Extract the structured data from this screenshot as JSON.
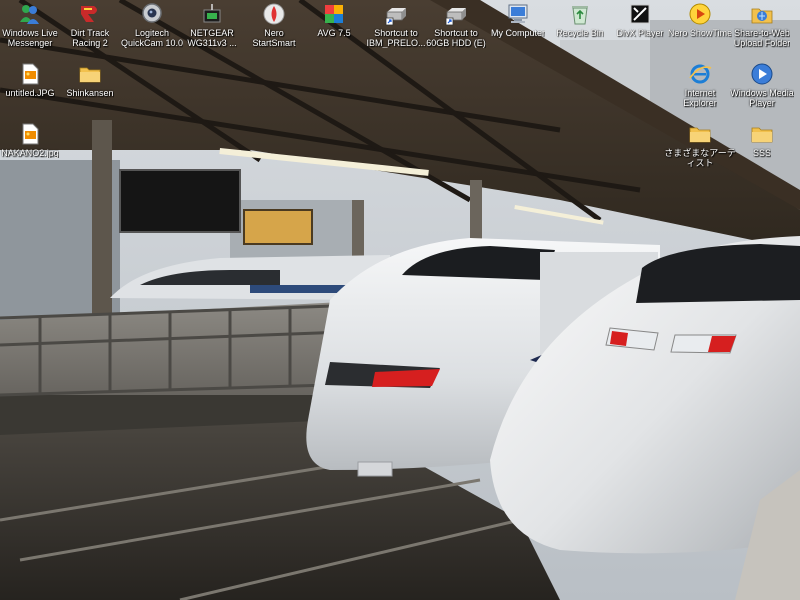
{
  "desktop": {
    "icons": [
      {
        "id": "wlm",
        "label": "Windows Live\nMessenger",
        "icon": "messenger-buddies-icon"
      },
      {
        "id": "dirt",
        "label": "Dirt Track\nRacing 2",
        "icon": "racing-game-icon"
      },
      {
        "id": "logi",
        "label": "Logitech\nQuickCam 10.0",
        "icon": "webcam-icon"
      },
      {
        "id": "netgear",
        "label": "NETGEAR\nWG311v3 ...",
        "icon": "wireless-adapter-icon"
      },
      {
        "id": "nero",
        "label": "Nero\nStartSmart",
        "icon": "nero-icon"
      },
      {
        "id": "avg",
        "label": "AVG 7.5",
        "icon": "antivirus-icon"
      },
      {
        "id": "ibm",
        "label": "Shortcut to\nIBM_PRELO...",
        "icon": "drive-shortcut-icon"
      },
      {
        "id": "hdd",
        "label": "Shortcut to\n60GB HDD (E)",
        "icon": "drive-shortcut-icon"
      },
      {
        "id": "mycomp",
        "label": "My Computer",
        "icon": "computer-icon"
      },
      {
        "id": "recycle",
        "label": "Recycle Bin",
        "icon": "recycle-bin-icon"
      },
      {
        "id": "divx",
        "label": "DivX Player",
        "icon": "media-player-icon"
      },
      {
        "id": "nerost",
        "label": "Nero ShowTime",
        "icon": "showtime-icon"
      },
      {
        "id": "share",
        "label": "Share-to-Web\nUpload Folder",
        "icon": "upload-folder-icon"
      },
      {
        "id": "untitled",
        "label": "untitled.JPG",
        "icon": "jpg-file-icon"
      },
      {
        "id": "shinkansen",
        "label": "Shinkansen",
        "icon": "folder-icon"
      },
      {
        "id": "ie",
        "label": "Internet\nExplorer",
        "icon": "internet-explorer-icon"
      },
      {
        "id": "wmp",
        "label": "Windows Media\nPlayer",
        "icon": "media-player-icon"
      },
      {
        "id": "nakano",
        "label": "NAKANO2.jpg",
        "icon": "jpg-file-icon"
      },
      {
        "id": "jpfolder",
        "label": "さまざまなアーテ\nィスト",
        "icon": "folder-icon"
      },
      {
        "id": "sss",
        "label": "SSS",
        "icon": "folder-icon"
      }
    ]
  },
  "colors": {
    "label_text": "#ffffff",
    "folder": "#f2c14e",
    "train_body": "#e8eaec",
    "tail_light": "#d61f1f"
  }
}
